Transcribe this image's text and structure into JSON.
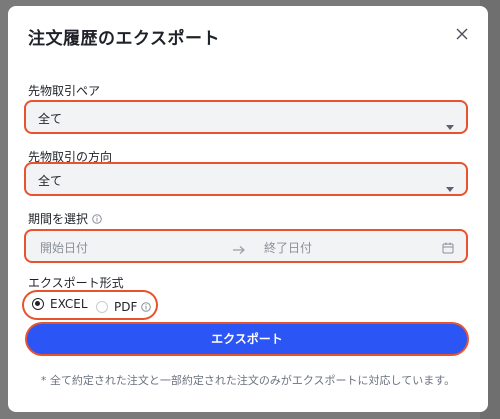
{
  "modal": {
    "title": "注文履歴のエクスポート"
  },
  "pair": {
    "label": "先物取引ペア",
    "value": "全て"
  },
  "direction": {
    "label": "先物取引の方向",
    "value": "全て"
  },
  "period": {
    "label": "期間を選択",
    "start_placeholder": "開始日付",
    "end_placeholder": "終了日付"
  },
  "format": {
    "label": "エクスポート形式",
    "options": [
      {
        "label": "EXCEL",
        "selected": true
      },
      {
        "label": "PDF",
        "selected": false
      }
    ]
  },
  "export_button": "エクスポート",
  "note": "* 全て約定された注文と一部約定された注文のみがエクスポートに対応しています。",
  "colors": {
    "primary": "#2b55f5",
    "highlight_outline": "#e8532f",
    "field_bg": "#f2f3f5"
  },
  "icons": [
    "close-icon",
    "chevron-down-icon",
    "info-icon",
    "arrow-right-icon",
    "calendar-icon"
  ]
}
